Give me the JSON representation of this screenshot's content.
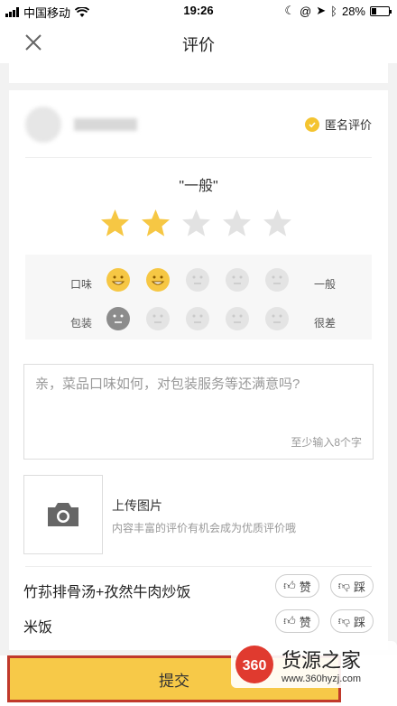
{
  "status_bar": {
    "carrier": "中国移动",
    "time": "19:26",
    "battery": "28%",
    "battery_level": 0.28
  },
  "nav": {
    "title": "评价"
  },
  "shop": {
    "anonymous_label": "匿名评价"
  },
  "rating": {
    "label": "\"一般\"",
    "stars_filled": 2,
    "stars_total": 5
  },
  "dimensions": [
    {
      "name": "口味",
      "value": "一般",
      "faces_on": 2
    },
    {
      "name": "包装",
      "value": "很差",
      "faces_on": 1
    }
  ],
  "comment": {
    "placeholder": "亲，菜品口味如何，对包装服务等还满意吗?",
    "hint": "至少输入8个字"
  },
  "upload": {
    "title": "上传图片",
    "subtitle": "内容丰富的评价有机会成为优质评价哦"
  },
  "dishes": [
    {
      "name": "竹荪排骨汤+孜然牛肉炒饭",
      "like": "赞",
      "dislike": "踩"
    },
    {
      "name": "米饭",
      "like": "赞",
      "dislike": "踩"
    }
  ],
  "submit_label": "提交",
  "watermark": {
    "logo": "360",
    "brand": "货源之家",
    "url": "www.360hyzj.com"
  },
  "colors": {
    "accent": "#f6c744",
    "submit": "#f7c948",
    "border_highlight": "#c0392b"
  }
}
